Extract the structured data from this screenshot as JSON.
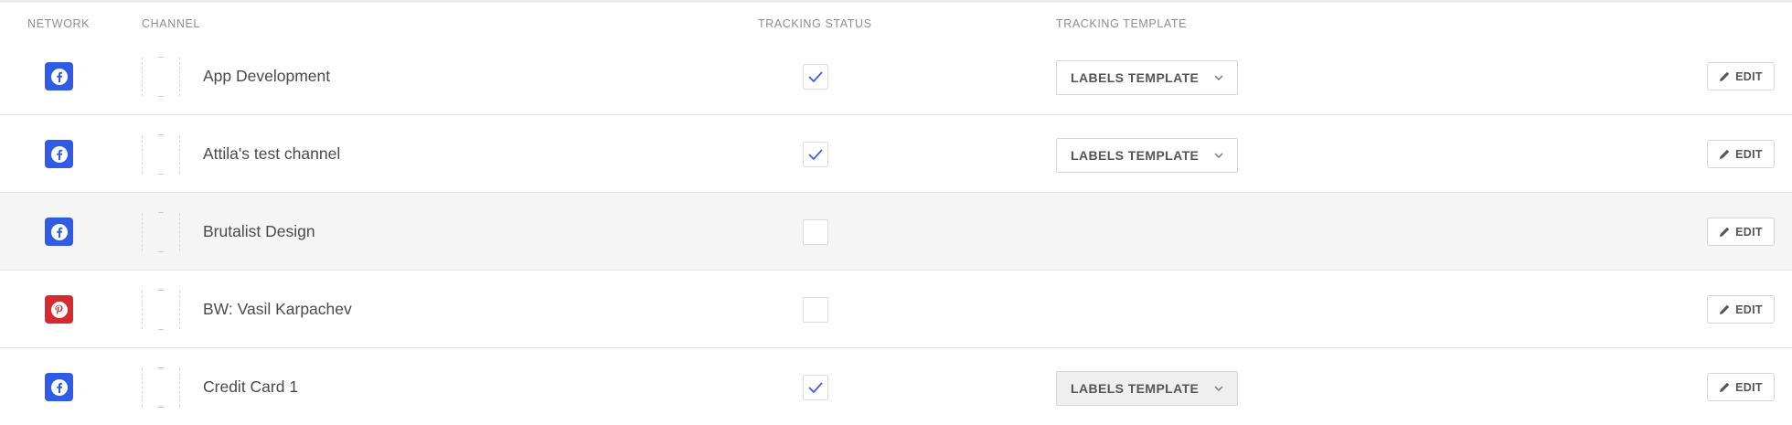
{
  "headers": {
    "network": "NETWORK",
    "channel": "CHANNEL",
    "tracking_status": "TRACKING STATUS",
    "tracking_template": "TRACKING TEMPLATE"
  },
  "rows": [
    {
      "network": "facebook-icon",
      "name": "App Development",
      "tracked": true,
      "template": "LABELS TEMPLATE",
      "edit": "EDIT"
    },
    {
      "network": "facebook-icon",
      "name": "Attila's test channel",
      "tracked": true,
      "template": "LABELS TEMPLATE",
      "edit": "EDIT"
    },
    {
      "network": "facebook-icon",
      "name": "Brutalist Design",
      "tracked": false,
      "template": "",
      "edit": "EDIT"
    },
    {
      "network": "pinterest-icon",
      "name": "BW: Vasil Karpachev",
      "tracked": false,
      "template": "",
      "edit": "EDIT"
    },
    {
      "network": "facebook-icon",
      "name": "Credit Card 1",
      "tracked": true,
      "template": "LABELS TEMPLATE",
      "edit": "EDIT"
    }
  ],
  "colors": {
    "facebook": "#2f5be7",
    "pinterest": "#d72a30",
    "check": "#3f5de0",
    "hover_row": "#f5f5f5"
  }
}
